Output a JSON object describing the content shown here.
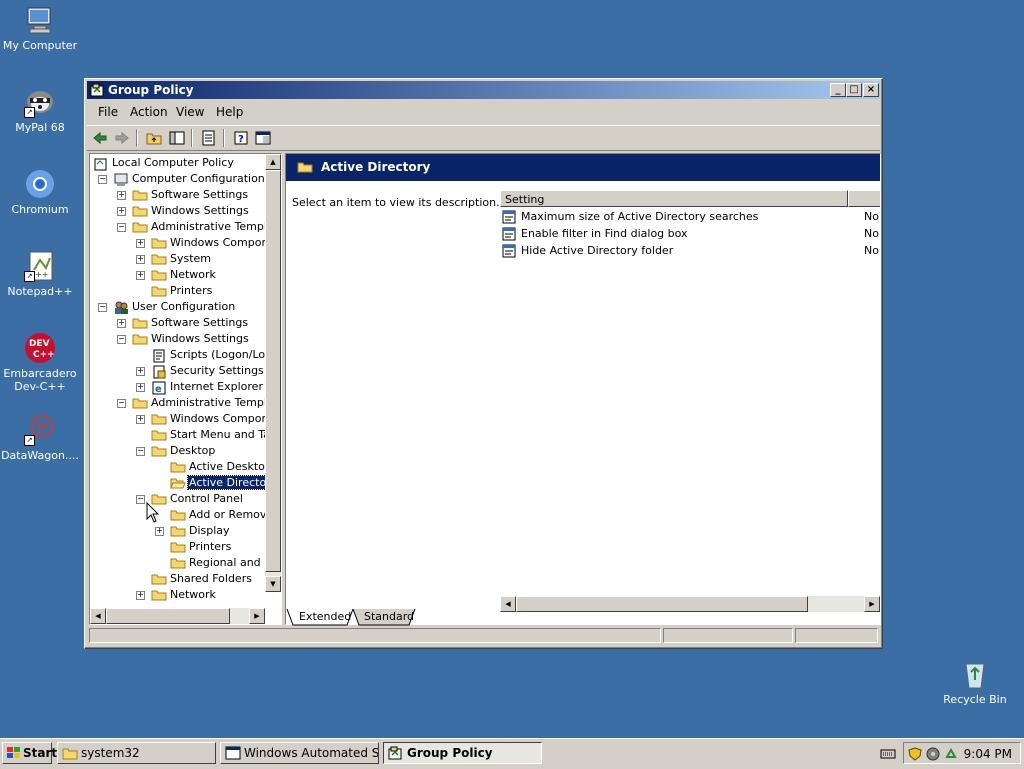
{
  "desktop": {
    "icons": [
      {
        "label": "My Computer"
      },
      {
        "label": "MyPal 68"
      },
      {
        "label": "Chromium"
      },
      {
        "label": "Notepad++"
      },
      {
        "label": "Embarcadero Dev-C++"
      },
      {
        "label": "DataWagon...."
      },
      {
        "label": "Recycle Bin"
      }
    ]
  },
  "window": {
    "title": "Group Policy",
    "menu": [
      "File",
      "Action",
      "View",
      "Help"
    ],
    "tree": [
      {
        "label": "Local Computer Policy"
      },
      {
        "label": "Computer Configuration"
      },
      {
        "label": "Software Settings"
      },
      {
        "label": "Windows Settings"
      },
      {
        "label": "Administrative Template"
      },
      {
        "label": "Windows Compone"
      },
      {
        "label": "System"
      },
      {
        "label": "Network"
      },
      {
        "label": "Printers"
      },
      {
        "label": "User Configuration"
      },
      {
        "label": "Software Settings"
      },
      {
        "label": "Windows Settings"
      },
      {
        "label": "Scripts (Logon/Log"
      },
      {
        "label": "Security Settings"
      },
      {
        "label": "Internet Explorer Ma"
      },
      {
        "label": "Administrative Template"
      },
      {
        "label": "Windows Compone"
      },
      {
        "label": "Start Menu and Tas"
      },
      {
        "label": "Desktop"
      },
      {
        "label": "Active Desktop"
      },
      {
        "label": "Active Directory"
      },
      {
        "label": "Control Panel"
      },
      {
        "label": "Add or Remove"
      },
      {
        "label": "Display"
      },
      {
        "label": "Printers"
      },
      {
        "label": "Regional and L"
      },
      {
        "label": "Shared Folders"
      },
      {
        "label": "Network"
      }
    ],
    "right": {
      "header": "Active Directory",
      "description": "Select an item to view its description.",
      "columns": {
        "setting": "Setting"
      },
      "settings": [
        {
          "name": "Maximum size of Active Directory searches",
          "state": "No"
        },
        {
          "name": "Enable filter in Find dialog box",
          "state": "No"
        },
        {
          "name": "Hide Active Directory folder",
          "state": "No"
        }
      ]
    },
    "tabs": [
      "Extended",
      "Standard"
    ]
  },
  "taskbar": {
    "start": "Start",
    "tasks": [
      {
        "label": "system32"
      },
      {
        "label": "Windows Automated Syst..."
      },
      {
        "label": "Group Policy"
      }
    ],
    "clock": "9:04 PM"
  },
  "colors": {
    "desktop": "#3a6ea5",
    "title_active": "#0a246a",
    "face": "#d4d0c8"
  }
}
